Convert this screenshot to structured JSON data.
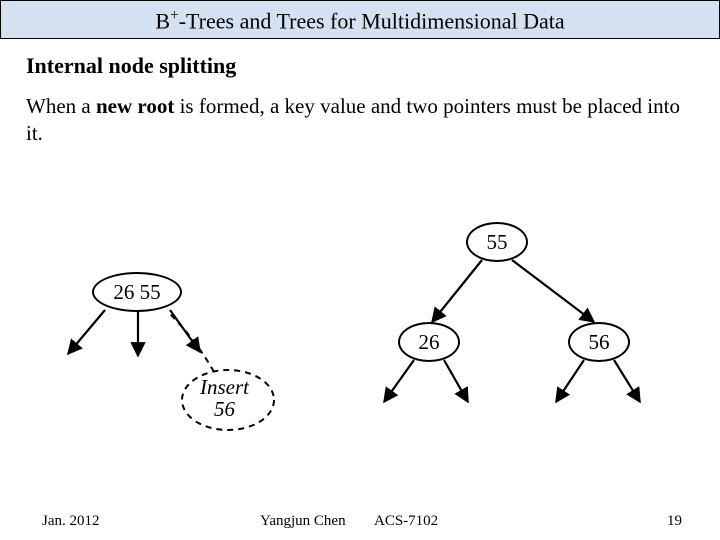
{
  "title_prefix": "B",
  "title_sup": "+",
  "title_rest": "-Trees and Trees for Multidimensional Data",
  "subheading": "Internal node splitting",
  "body_line1": "When a ",
  "body_bold": "new root",
  "body_line2": " is formed, a key value and two pointers must be placed into it.",
  "node_left": "26  55",
  "node_root": "55",
  "node_c26": "26",
  "node_c56": "56",
  "insert_word": "Insert",
  "insert_val": "56",
  "footer": {
    "date": "Jan. 2012",
    "author": "Yangjun Chen",
    "course": "ACS-7102",
    "page": "19"
  }
}
